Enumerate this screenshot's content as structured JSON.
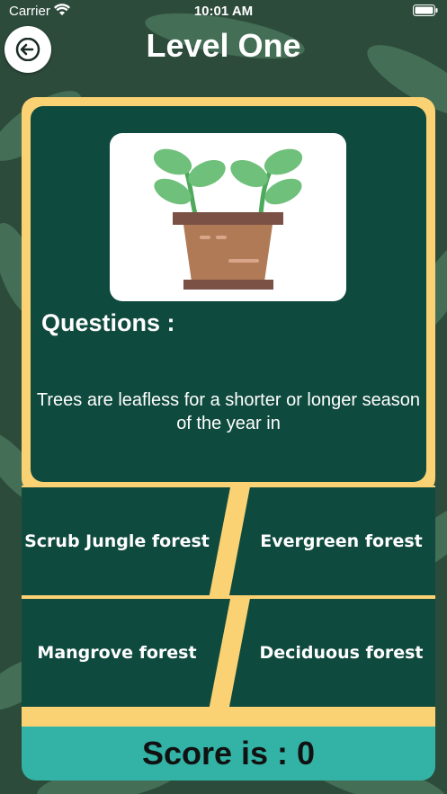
{
  "status_bar": {
    "carrier": "Carrier",
    "time": "10:01 AM"
  },
  "header": {
    "title": "Level One"
  },
  "question": {
    "label": "Questions :",
    "text": "Trees are leafless for a shorter or longer season of the year in",
    "image": "potted-plant-icon"
  },
  "answers": [
    {
      "label": "Scrub Jungle forest"
    },
    {
      "label": "Evergreen forest"
    },
    {
      "label": "Mangrove forest"
    },
    {
      "label": "Deciduous forest"
    }
  ],
  "score": {
    "text": "Score is : 0"
  },
  "colors": {
    "card": "#0f4a3e",
    "border": "#fbd273",
    "score_bar": "#33b3a6"
  }
}
